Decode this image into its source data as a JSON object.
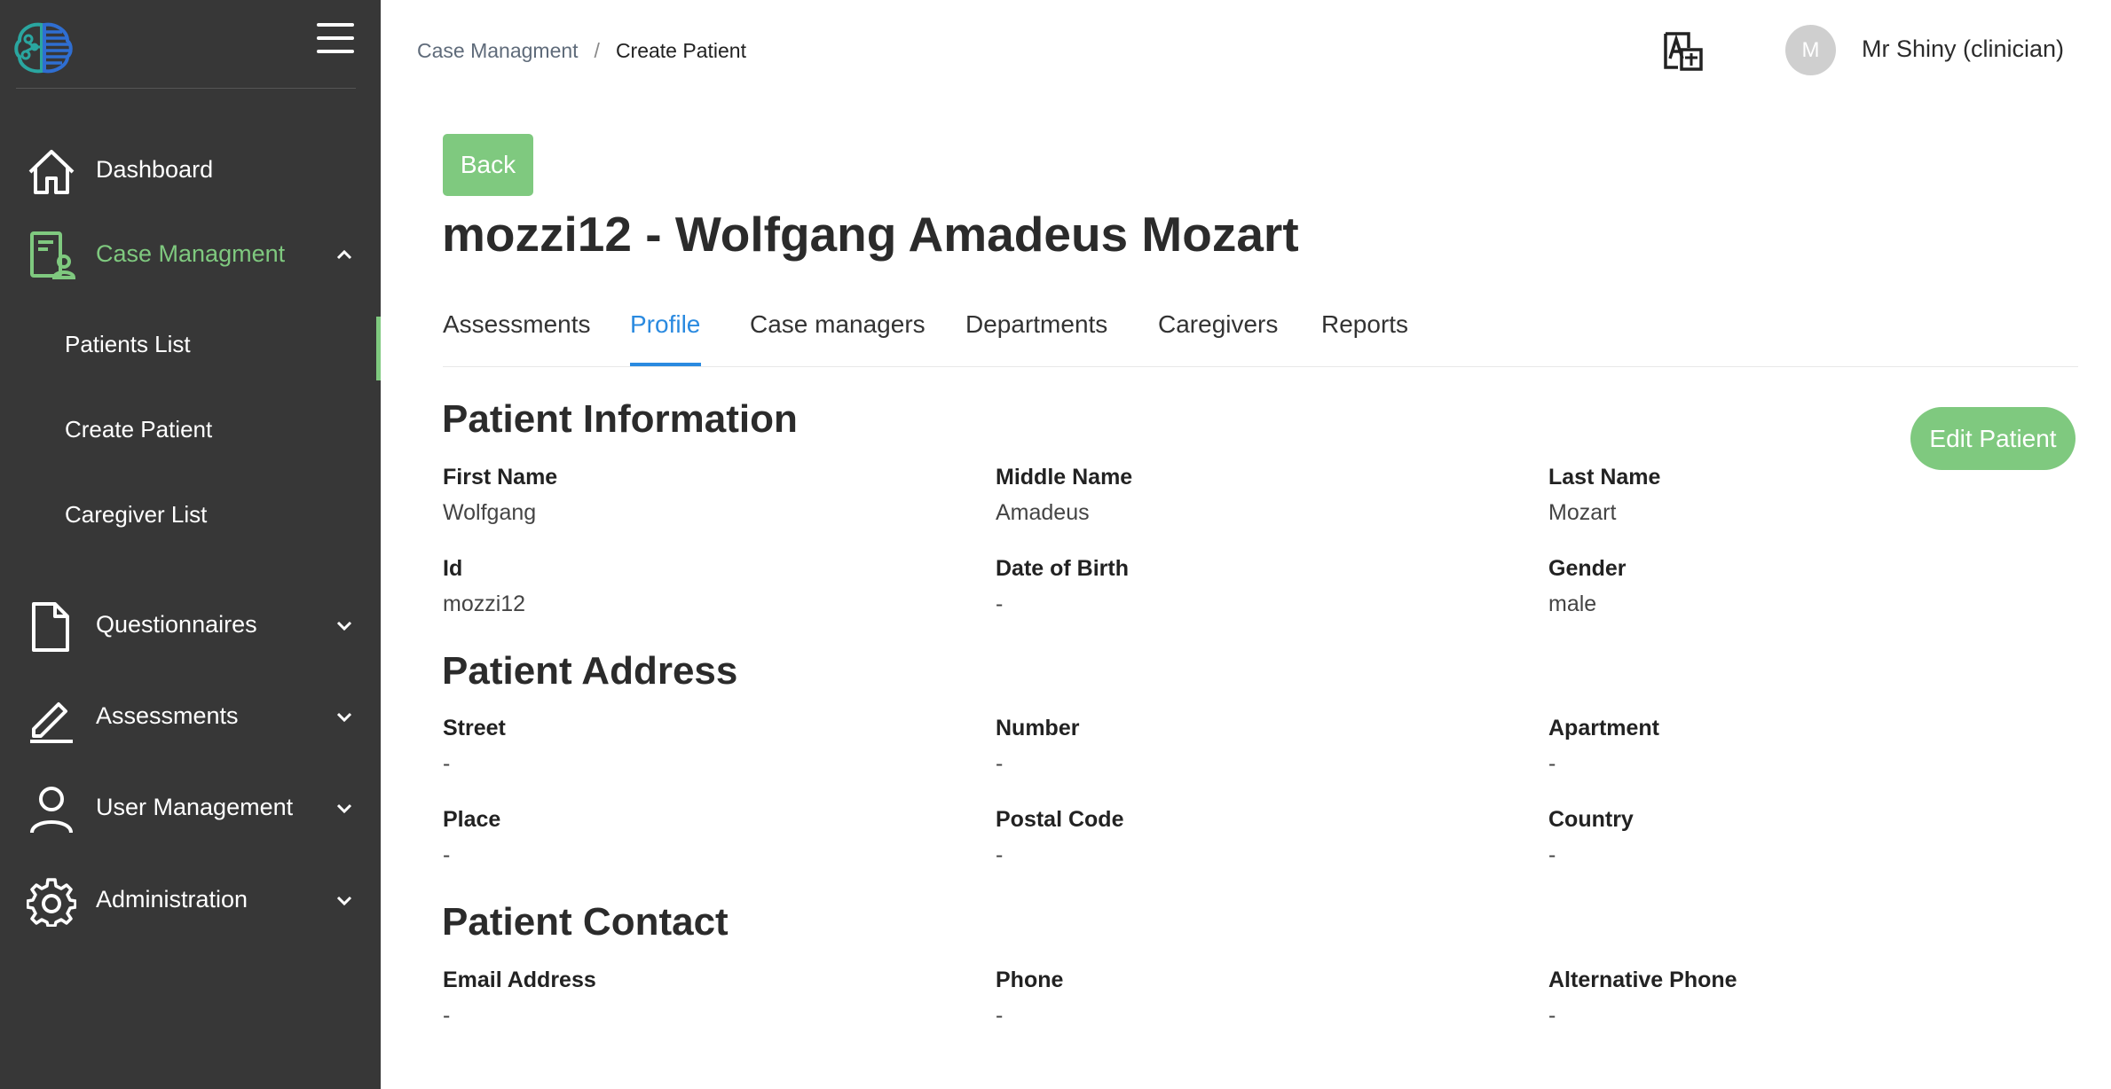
{
  "colors": {
    "sidebar_bg": "#373737",
    "accent_green": "#7fc97f",
    "tab_active_blue": "#2a8ae0"
  },
  "sidebar": {
    "items": [
      {
        "label": "Dashboard",
        "icon": "home-icon"
      },
      {
        "label": "Case Managment",
        "icon": "case-file-icon",
        "expanded": true,
        "active": true,
        "children": [
          {
            "label": "Patients List",
            "selected": true
          },
          {
            "label": "Create Patient"
          },
          {
            "label": "Caregiver List"
          }
        ]
      },
      {
        "label": "Questionnaires",
        "icon": "document-icon"
      },
      {
        "label": "Assessments",
        "icon": "pencil-icon"
      },
      {
        "label": "User Management",
        "icon": "user-icon"
      },
      {
        "label": "Administration",
        "icon": "gear-icon"
      }
    ]
  },
  "header": {
    "breadcrumb": [
      "Case Managment",
      "Create Patient"
    ],
    "breadcrumb_sep": "/",
    "user": {
      "avatar_initial": "M",
      "name": "Mr Shiny (clinician)"
    }
  },
  "main": {
    "back_label": "Back",
    "title": "mozzi12 - Wolfgang Amadeus Mozart",
    "tabs": [
      "Assessments",
      "Profile",
      "Case managers",
      "Departments",
      "Caregivers",
      "Reports"
    ],
    "active_tab": "Profile",
    "edit_label": "Edit Patient",
    "sections": {
      "info": {
        "title": "Patient Information",
        "fields": [
          {
            "label": "First Name",
            "value": "Wolfgang"
          },
          {
            "label": "Middle Name",
            "value": "Amadeus"
          },
          {
            "label": "Last Name",
            "value": "Mozart"
          },
          {
            "label": "Id",
            "value": "mozzi12"
          },
          {
            "label": "Date of Birth",
            "value": "-"
          },
          {
            "label": "Gender",
            "value": "male"
          }
        ]
      },
      "address": {
        "title": "Patient Address",
        "fields": [
          {
            "label": "Street",
            "value": "-"
          },
          {
            "label": "Number",
            "value": "-"
          },
          {
            "label": "Apartment",
            "value": "-"
          },
          {
            "label": "Place",
            "value": "-"
          },
          {
            "label": "Postal Code",
            "value": "-"
          },
          {
            "label": "Country",
            "value": "-"
          }
        ]
      },
      "contact": {
        "title": "Patient Contact",
        "fields": [
          {
            "label": "Email Address",
            "value": "-"
          },
          {
            "label": "Phone",
            "value": "-"
          },
          {
            "label": "Alternative Phone",
            "value": "-"
          }
        ]
      }
    }
  }
}
